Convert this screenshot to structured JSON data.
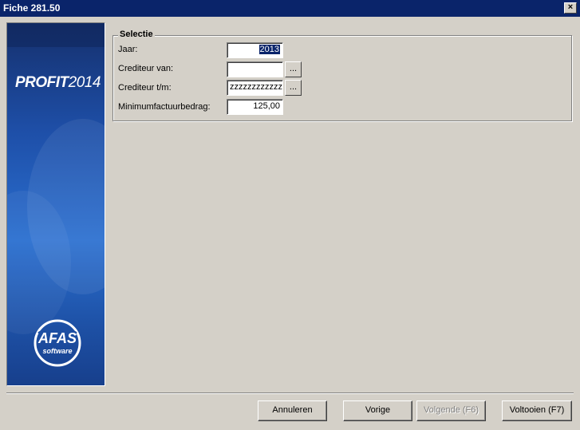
{
  "window": {
    "title": "Fiche 281.50",
    "close_glyph": "×"
  },
  "banner": {
    "product_prefix": "PROFIT",
    "product_year": "2014",
    "logo_text": "AFAS",
    "logo_sub": "software",
    "icons": [
      "afas-logo-icon"
    ]
  },
  "selectie": {
    "legend": "Selectie",
    "jaar": {
      "label": "Jaar:",
      "value": "2013"
    },
    "crediteur_van": {
      "label": "Crediteur van:",
      "value": "",
      "browse_label": "..."
    },
    "crediteur_tm": {
      "label": "Crediteur t/m:",
      "value": "zzzzzzzzzzzz",
      "browse_label": "..."
    },
    "minimum": {
      "label": "Minimumfactuurbedrag:",
      "value": "125,00"
    }
  },
  "buttons": {
    "annuleren": "Annuleren",
    "vorige": "Vorige",
    "volgende": "Volgende (F6)",
    "voltooien": "Voltooien (F7)"
  },
  "colors": {
    "titlebar": "#0a246a",
    "face": "#d4d0c8",
    "banner_blue": "#2a6fd0"
  }
}
